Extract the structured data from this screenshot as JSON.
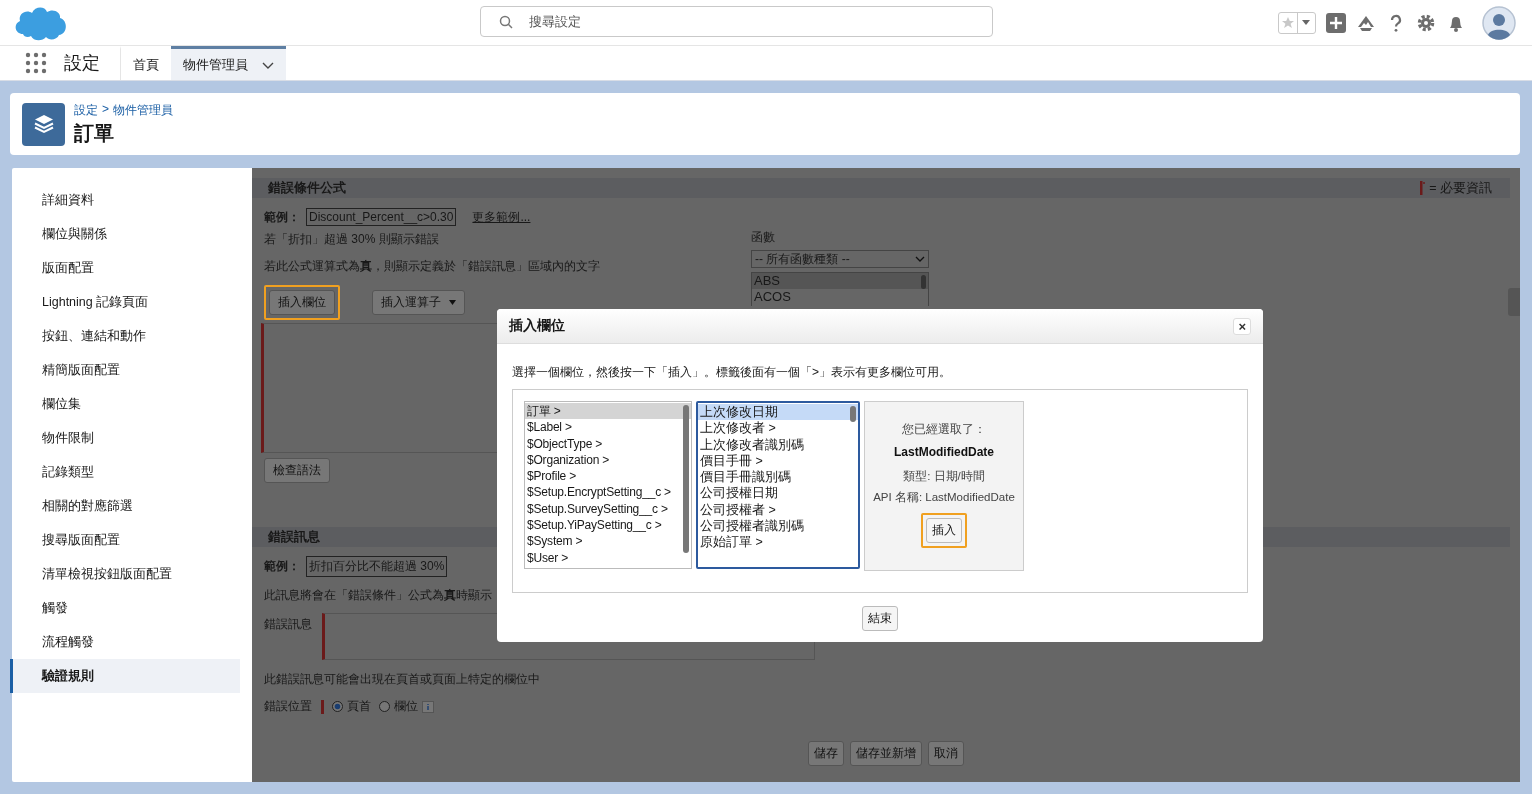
{
  "search": {
    "placeholder": "搜尋設定"
  },
  "nav": {
    "app_name": "設定",
    "tabs": [
      {
        "label": "首頁",
        "selected": false
      },
      {
        "label": "物件管理員",
        "selected": true
      }
    ]
  },
  "page_header": {
    "breadcrumb": [
      "設定",
      "物件管理員"
    ],
    "separator": ">",
    "title": "訂單"
  },
  "sidebar": {
    "items": [
      {
        "label": "詳細資料",
        "selected": false
      },
      {
        "label": "欄位與關係",
        "selected": false
      },
      {
        "label": "版面配置",
        "selected": false
      },
      {
        "label": "Lightning 記錄頁面",
        "selected": false
      },
      {
        "label": "按鈕、連結和動作",
        "selected": false
      },
      {
        "label": "精簡版面配置",
        "selected": false
      },
      {
        "label": "欄位集",
        "selected": false
      },
      {
        "label": "物件限制",
        "selected": false
      },
      {
        "label": "記錄類型",
        "selected": false
      },
      {
        "label": "相關的對應篩選",
        "selected": false
      },
      {
        "label": "搜尋版面配置",
        "selected": false
      },
      {
        "label": "清單檢視按鈕版面配置",
        "selected": false
      },
      {
        "label": "觸發",
        "selected": false
      },
      {
        "label": "流程觸發",
        "selected": false
      },
      {
        "label": "驗證規則",
        "selected": true
      }
    ]
  },
  "formula_section": {
    "title": "錯誤條件公式",
    "required_legend": "= 必要資訊",
    "example_label": "範例：",
    "example": "Discount_Percent__c>0.30",
    "more_examples": "更多範例...",
    "example_note": "若「折扣」超過 30% 則顯示錯誤",
    "hint": "若此公式運算式為**真**，則顯示定義於「錯誤訊息」區域內的文字",
    "buttons": [
      {
        "label": "插入欄位",
        "highlighted": true,
        "kind": "plain"
      },
      {
        "label": "插入運算子",
        "highlighted": false,
        "kind": "dropdown"
      }
    ],
    "check_syntax": "檢查語法",
    "functions_label": "函數",
    "function_category": "-- 所有函數種類 --",
    "functions": [
      {
        "label": "ABS",
        "selected": true
      },
      {
        "label": "ACOS",
        "selected": false
      }
    ]
  },
  "message_section": {
    "title": "錯誤訊息",
    "example_label": "範例：",
    "example": "折扣百分比不能超過 30%",
    "note": "此訊息將會在「錯誤條件」公式為**真**時顯示",
    "message_label": "錯誤訊息",
    "location_note": "此錯誤訊息可能會出現在頁首或頁面上特定的欄位中",
    "location_label": "錯誤位置",
    "location_options": [
      {
        "label": "頁首",
        "selected": true
      },
      {
        "label": "欄位",
        "selected": false
      }
    ]
  },
  "footer_buttons": [
    "儲存",
    "儲存並新增",
    "取消"
  ],
  "modal": {
    "title": "插入欄位",
    "close": "×",
    "instruction": "選擇一個欄位，然後按一下「插入」。標籤後面有一個「>」表示有更多欄位可用。",
    "objects": [
      {
        "label": "訂單 >",
        "selected": true
      },
      {
        "label": "$Label >",
        "selected": false
      },
      {
        "label": "$ObjectType >",
        "selected": false
      },
      {
        "label": "$Organization >",
        "selected": false
      },
      {
        "label": "$Profile >",
        "selected": false
      },
      {
        "label": "$Setup.EncryptSetting__c >",
        "selected": false
      },
      {
        "label": "$Setup.SurveySetting__c >",
        "selected": false
      },
      {
        "label": "$Setup.YiPaySetting__c >",
        "selected": false
      },
      {
        "label": "$System >",
        "selected": false
      },
      {
        "label": "$User >",
        "selected": false
      }
    ],
    "fields": [
      {
        "label": "上次修改日期",
        "selected": true
      },
      {
        "label": "上次修改者 >",
        "selected": false
      },
      {
        "label": "上次修改者識別碼",
        "selected": false
      },
      {
        "label": "價目手冊 >",
        "selected": false
      },
      {
        "label": "價目手冊識別碼",
        "selected": false
      },
      {
        "label": "公司授權日期",
        "selected": false
      },
      {
        "label": "公司授權者 >",
        "selected": false
      },
      {
        "label": "公司授權者識別碼",
        "selected": false
      },
      {
        "label": "原始訂單 >",
        "selected": false
      }
    ],
    "selection_title": "您已經選取了：",
    "selected_field": "LastModifiedDate",
    "type_line": "類型: 日期/時間",
    "api_line": "API 名稱: LastModifiedDate",
    "insert_button": {
      "label": "插入",
      "highlighted": true
    },
    "done_button": "結束"
  }
}
